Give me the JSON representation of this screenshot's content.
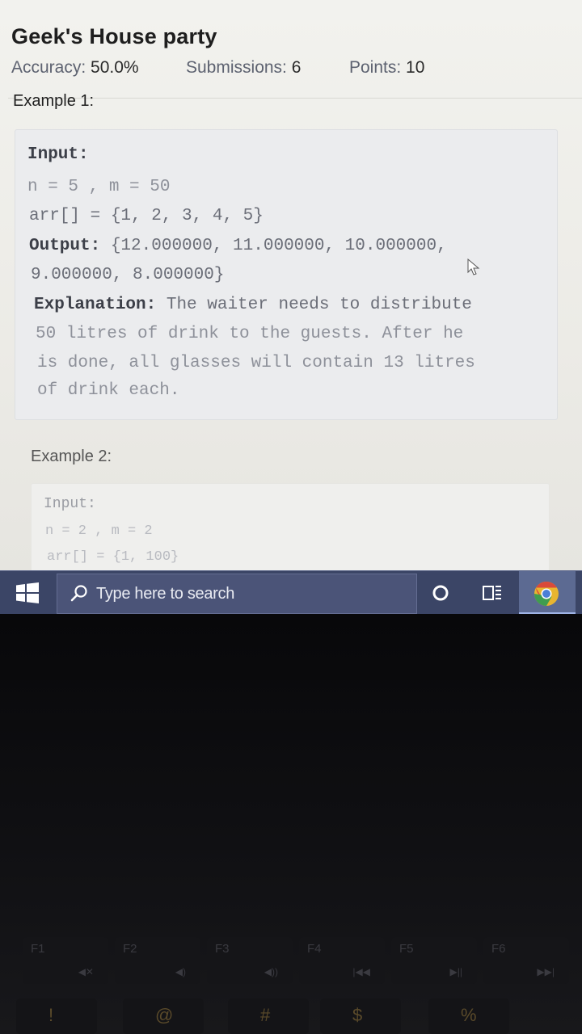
{
  "problem": {
    "title": "Geek's House party",
    "accuracy_label": "Accuracy:",
    "accuracy_value": "50.0%",
    "submissions_label": "Submissions:",
    "submissions_value": "6",
    "points_label": "Points:",
    "points_value": "10"
  },
  "example1": {
    "heading": "Example 1:",
    "input_label": "Input:",
    "line_nm": "n = 5 , m = 50",
    "line_arr": "arr[] = {1, 2, 3, 4, 5}",
    "output_label": "Output:",
    "output_value_1": "{12.000000, 11.000000, 10.000000,",
    "output_value_2": "9.000000, 8.000000}",
    "explanation_label": "Explanation:",
    "explanation_1": "The waiter needs to distribute",
    "explanation_2": "50 litres of drink to the guests. After he",
    "explanation_3": "is done, all glasses will contain 13 litres",
    "explanation_4": "of drink each."
  },
  "example2": {
    "heading": "Example 2:",
    "input_label": "Input:",
    "line_nm": "n = 2 , m = 2",
    "line_arr": "arr[] = {1, 100}"
  },
  "taskbar": {
    "search_placeholder": "Type here to search",
    "start_icon": "windows-logo-icon",
    "search_icon": "search-icon",
    "cortana_icon": "cortana-circle-icon",
    "taskview_icon": "task-view-icon",
    "app_icon": "chrome-icon",
    "bar_color": "#3b4566",
    "active_color": "#5c6a92"
  },
  "keyboard": {
    "function_keys": [
      {
        "label": "F1",
        "glyph": "◀✕"
      },
      {
        "label": "F2",
        "glyph": "◀)"
      },
      {
        "label": "F3",
        "glyph": "◀))"
      },
      {
        "label": "F4",
        "glyph": "|◀◀"
      },
      {
        "label": "F5",
        "glyph": "▶||"
      },
      {
        "label": "F6",
        "glyph": "▶▶|"
      }
    ],
    "number_row": [
      "!",
      "@",
      "#",
      "$",
      "%"
    ]
  }
}
